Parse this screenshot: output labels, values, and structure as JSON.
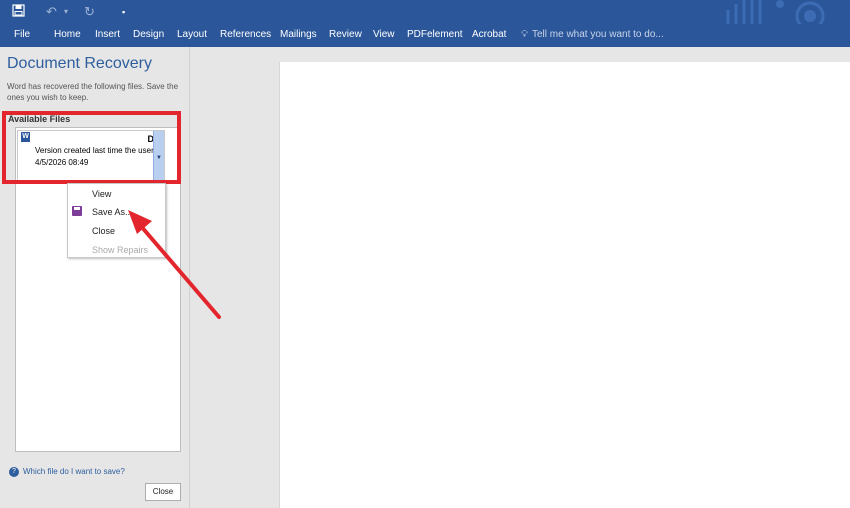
{
  "quick_access": {
    "save_icon": "save-icon",
    "undo_icon": "undo-icon",
    "redo_icon": "redo-icon"
  },
  "ribbon": {
    "tabs": [
      "File",
      "Home",
      "Insert",
      "Design",
      "Layout",
      "References",
      "Mailings",
      "Review",
      "View",
      "PDFelement",
      "Acrobat"
    ],
    "tell_me": "Tell me what you want to do...",
    "tell_me_icon": "lightbulb-icon",
    "color": "#2b579a"
  },
  "recovery_pane": {
    "title": "Document Recovery",
    "description": "Word has recovered the following files.  Save the ones you wish to keep.",
    "available_label": "Available Files",
    "file": {
      "name": "D",
      "version": "Version created last time the user",
      "date": "4/5/2026 08:49",
      "icon": "word-file-icon"
    },
    "context_menu": {
      "items": [
        "View",
        "Save As...",
        "Close",
        "Show Repairs"
      ],
      "disabled_item": "Show Repairs"
    },
    "help_text": "Which file do I want to save?",
    "close_button": "Close"
  },
  "annotations": {
    "highlight_color": "#e3262d",
    "arrow_color": "#e3262d"
  }
}
